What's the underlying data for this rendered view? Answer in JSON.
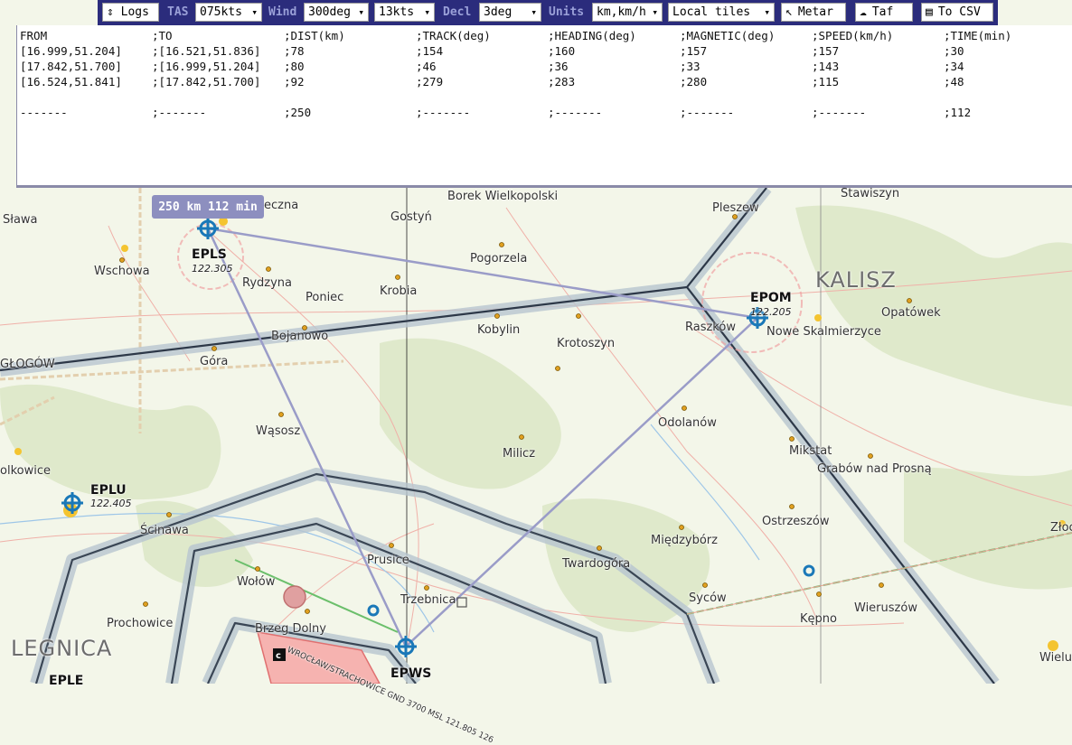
{
  "toolbar": {
    "logs": "⇕ Logs",
    "tas_label": "TAS",
    "tas_value": "075kts",
    "wind_label": "Wind",
    "wind_dir": "300deg",
    "wind_speed": "13kts",
    "decl_label": "Decl",
    "decl_value": "3deg",
    "units_label": "Units",
    "units_value": "km,km/h",
    "tiles_value": "Local tiles",
    "metar": "Metar",
    "taf": "Taf",
    "csv": "To CSV"
  },
  "log": {
    "headers": [
      "FROM",
      ";TO",
      ";DIST(km)",
      ";TRACK(deg)",
      ";HEADING(deg)",
      ";MAGNETIC(deg)",
      ";SPEED(km/h)",
      ";TIME(min)"
    ],
    "rows": [
      [
        "[16.999,51.204]",
        ";[16.521,51.836]",
        ";78",
        ";154",
        ";160",
        ";157",
        ";157",
        ";30"
      ],
      [
        "[17.842,51.700]",
        ";[16.999,51.204]",
        ";80",
        ";46",
        ";36",
        ";33",
        ";143",
        ";34"
      ],
      [
        "[16.524,51.841]",
        ";[17.842,51.700]",
        ";92",
        ";279",
        ";283",
        ";280",
        ";115",
        ";48"
      ]
    ],
    "total": [
      "-------",
      ";-------",
      ";250",
      ";-------",
      ";-------",
      ";-------",
      ";-------",
      ";112"
    ]
  },
  "distance_label": "250 km 112 min",
  "map": {
    "towns": {
      "slawa": "Sława",
      "wschowa": "Wschowa",
      "leszno": "eczna",
      "gostyn": "Gostyń",
      "borek": "Borek Wielkopolski",
      "pleszew": "Pleszew",
      "stawiszyn": "Stawiszyn",
      "pogorzela": "Pogorzela",
      "rydzyna": "Rydzyna",
      "poniec": "Poniec",
      "krobia": "Krobia",
      "raszkow": "Raszków",
      "nowe": "Nowe Skalmierzyce",
      "opatowek": "Opatówek",
      "bojanowo": "Bojanowo",
      "kobylin": "Kobylin",
      "krotoszyn": "Krotoszyn",
      "glogow": "GŁOGÓW",
      "gora": "Góra",
      "odolanow": "Odolanów",
      "wasosz": "Wąsosz",
      "milicz": "Milicz",
      "mikstat": "Mikstat",
      "grabow": "Grabów nad Prosną",
      "olkowice": "olkowice",
      "scinawa": "Ścinawa",
      "ostrzeszow": "Ostrzeszów",
      "zloczew": "Złoc",
      "miedzyborz": "Międzybórz",
      "twardogora": "Twardogóra",
      "prusice": "Prusice",
      "wolow": "Wołów",
      "trzebnica": "Trzebnica",
      "sycow": "Syców",
      "wieruszow": "Wieruszów",
      "prochowice": "Prochowice",
      "brzeg": "Brzeg Dolny",
      "kepno": "Kępno",
      "wielun": "Wielu",
      "kalisz": "KALISZ",
      "legnica": "LEGNICA",
      "eple": "EPLE"
    },
    "airports": {
      "epls_name": "EPLS",
      "epls_freq": "122.305",
      "epom_name": "EPOM",
      "epom_freq": "122.205",
      "eplu_name": "EPLU",
      "eplu_freq": "122.405",
      "epws_name": "EPWS",
      "epws_note": "WROCŁAW/STRACHOWICE GND 3700 MSL 121.805 126"
    }
  }
}
